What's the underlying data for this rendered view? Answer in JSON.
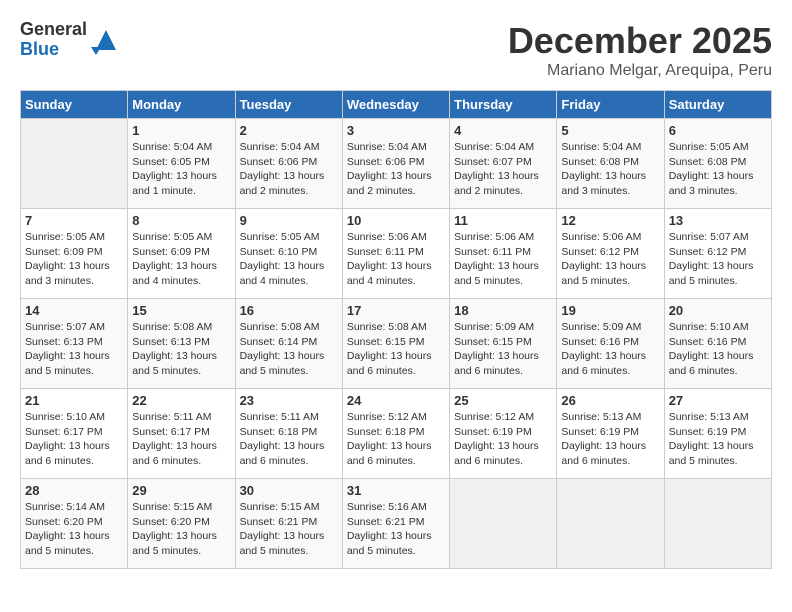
{
  "header": {
    "logo_general": "General",
    "logo_blue": "Blue",
    "title": "December 2025",
    "location": "Mariano Melgar, Arequipa, Peru"
  },
  "weekdays": [
    "Sunday",
    "Monday",
    "Tuesday",
    "Wednesday",
    "Thursday",
    "Friday",
    "Saturday"
  ],
  "weeks": [
    [
      {
        "num": "",
        "info": ""
      },
      {
        "num": "1",
        "info": "Sunrise: 5:04 AM\nSunset: 6:05 PM\nDaylight: 13 hours\nand 1 minute."
      },
      {
        "num": "2",
        "info": "Sunrise: 5:04 AM\nSunset: 6:06 PM\nDaylight: 13 hours\nand 2 minutes."
      },
      {
        "num": "3",
        "info": "Sunrise: 5:04 AM\nSunset: 6:06 PM\nDaylight: 13 hours\nand 2 minutes."
      },
      {
        "num": "4",
        "info": "Sunrise: 5:04 AM\nSunset: 6:07 PM\nDaylight: 13 hours\nand 2 minutes."
      },
      {
        "num": "5",
        "info": "Sunrise: 5:04 AM\nSunset: 6:08 PM\nDaylight: 13 hours\nand 3 minutes."
      },
      {
        "num": "6",
        "info": "Sunrise: 5:05 AM\nSunset: 6:08 PM\nDaylight: 13 hours\nand 3 minutes."
      }
    ],
    [
      {
        "num": "7",
        "info": "Sunrise: 5:05 AM\nSunset: 6:09 PM\nDaylight: 13 hours\nand 3 minutes."
      },
      {
        "num": "8",
        "info": "Sunrise: 5:05 AM\nSunset: 6:09 PM\nDaylight: 13 hours\nand 4 minutes."
      },
      {
        "num": "9",
        "info": "Sunrise: 5:05 AM\nSunset: 6:10 PM\nDaylight: 13 hours\nand 4 minutes."
      },
      {
        "num": "10",
        "info": "Sunrise: 5:06 AM\nSunset: 6:11 PM\nDaylight: 13 hours\nand 4 minutes."
      },
      {
        "num": "11",
        "info": "Sunrise: 5:06 AM\nSunset: 6:11 PM\nDaylight: 13 hours\nand 5 minutes."
      },
      {
        "num": "12",
        "info": "Sunrise: 5:06 AM\nSunset: 6:12 PM\nDaylight: 13 hours\nand 5 minutes."
      },
      {
        "num": "13",
        "info": "Sunrise: 5:07 AM\nSunset: 6:12 PM\nDaylight: 13 hours\nand 5 minutes."
      }
    ],
    [
      {
        "num": "14",
        "info": "Sunrise: 5:07 AM\nSunset: 6:13 PM\nDaylight: 13 hours\nand 5 minutes."
      },
      {
        "num": "15",
        "info": "Sunrise: 5:08 AM\nSunset: 6:13 PM\nDaylight: 13 hours\nand 5 minutes."
      },
      {
        "num": "16",
        "info": "Sunrise: 5:08 AM\nSunset: 6:14 PM\nDaylight: 13 hours\nand 5 minutes."
      },
      {
        "num": "17",
        "info": "Sunrise: 5:08 AM\nSunset: 6:15 PM\nDaylight: 13 hours\nand 6 minutes."
      },
      {
        "num": "18",
        "info": "Sunrise: 5:09 AM\nSunset: 6:15 PM\nDaylight: 13 hours\nand 6 minutes."
      },
      {
        "num": "19",
        "info": "Sunrise: 5:09 AM\nSunset: 6:16 PM\nDaylight: 13 hours\nand 6 minutes."
      },
      {
        "num": "20",
        "info": "Sunrise: 5:10 AM\nSunset: 6:16 PM\nDaylight: 13 hours\nand 6 minutes."
      }
    ],
    [
      {
        "num": "21",
        "info": "Sunrise: 5:10 AM\nSunset: 6:17 PM\nDaylight: 13 hours\nand 6 minutes."
      },
      {
        "num": "22",
        "info": "Sunrise: 5:11 AM\nSunset: 6:17 PM\nDaylight: 13 hours\nand 6 minutes."
      },
      {
        "num": "23",
        "info": "Sunrise: 5:11 AM\nSunset: 6:18 PM\nDaylight: 13 hours\nand 6 minutes."
      },
      {
        "num": "24",
        "info": "Sunrise: 5:12 AM\nSunset: 6:18 PM\nDaylight: 13 hours\nand 6 minutes."
      },
      {
        "num": "25",
        "info": "Sunrise: 5:12 AM\nSunset: 6:19 PM\nDaylight: 13 hours\nand 6 minutes."
      },
      {
        "num": "26",
        "info": "Sunrise: 5:13 AM\nSunset: 6:19 PM\nDaylight: 13 hours\nand 6 minutes."
      },
      {
        "num": "27",
        "info": "Sunrise: 5:13 AM\nSunset: 6:19 PM\nDaylight: 13 hours\nand 5 minutes."
      }
    ],
    [
      {
        "num": "28",
        "info": "Sunrise: 5:14 AM\nSunset: 6:20 PM\nDaylight: 13 hours\nand 5 minutes."
      },
      {
        "num": "29",
        "info": "Sunrise: 5:15 AM\nSunset: 6:20 PM\nDaylight: 13 hours\nand 5 minutes."
      },
      {
        "num": "30",
        "info": "Sunrise: 5:15 AM\nSunset: 6:21 PM\nDaylight: 13 hours\nand 5 minutes."
      },
      {
        "num": "31",
        "info": "Sunrise: 5:16 AM\nSunset: 6:21 PM\nDaylight: 13 hours\nand 5 minutes."
      },
      {
        "num": "",
        "info": ""
      },
      {
        "num": "",
        "info": ""
      },
      {
        "num": "",
        "info": ""
      }
    ]
  ]
}
